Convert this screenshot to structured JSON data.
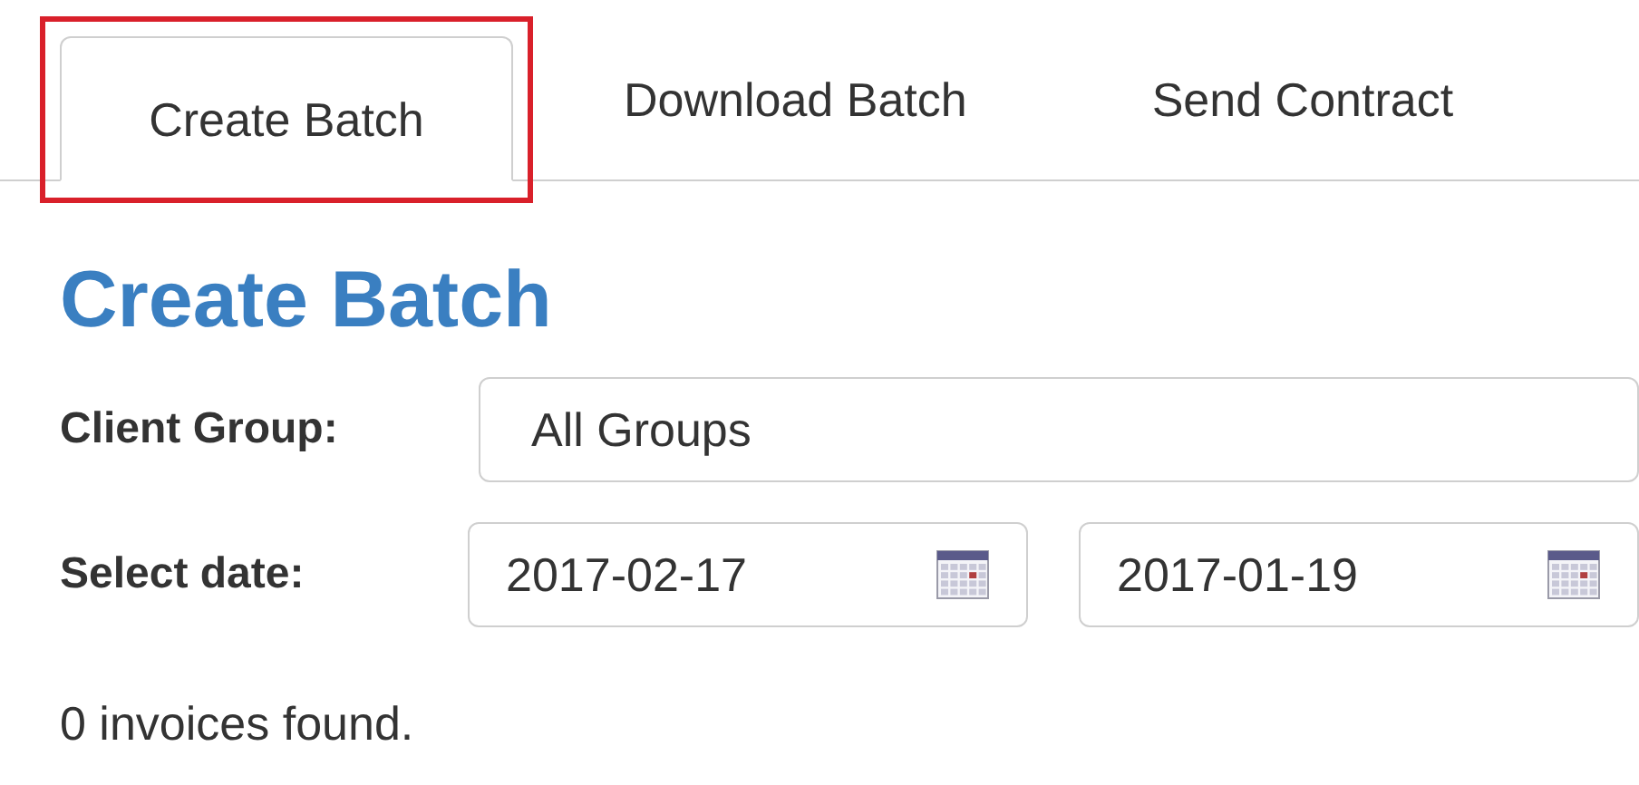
{
  "tabs": [
    {
      "label": "Create Batch",
      "selected": true,
      "highlighted": true
    },
    {
      "label": "Download Batch",
      "selected": false,
      "highlighted": false
    },
    {
      "label": "Send Contract",
      "selected": false,
      "highlighted": false
    }
  ],
  "heading": "Create Batch",
  "form": {
    "client_group": {
      "label": "Client Group:",
      "value": "All Groups"
    },
    "select_date": {
      "label": "Select date:",
      "from": "2017-02-17",
      "to": "2017-01-19"
    }
  },
  "status": "0 invoices found."
}
